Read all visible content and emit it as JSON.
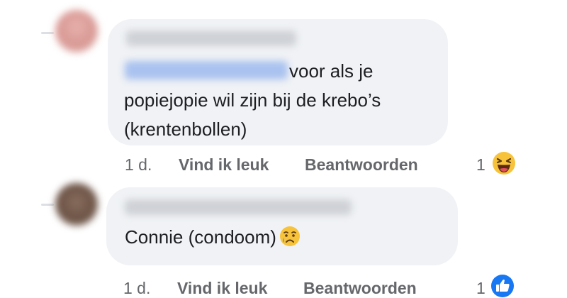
{
  "comments": [
    {
      "author_name": "",
      "text_line1": "voor als je",
      "text_line2": "popiejopie wil zijn bij de krebo’s",
      "text_line3": "(krentenbollen)",
      "time": "1 d.",
      "like_label": "Vind ik leuk",
      "reply_label": "Beantwoorden",
      "reaction_count": "1",
      "reaction_icon": "laughing-emoji-icon"
    },
    {
      "author_name": "",
      "text": "Connie (condoom)",
      "inline_emoji": "crying-face-icon",
      "time": "1 d.",
      "like_label": "Vind ik leuk",
      "reply_label": "Beantwoorden",
      "reaction_count": "1",
      "reaction_icon": "thumbs-up-icon"
    }
  ],
  "colors": {
    "bubble": "#f0f2f5",
    "meta_text": "#65676b",
    "body_text": "#1c1e21",
    "like_blue": "#1877f2",
    "emoji_yellow": "#f7c33a"
  }
}
